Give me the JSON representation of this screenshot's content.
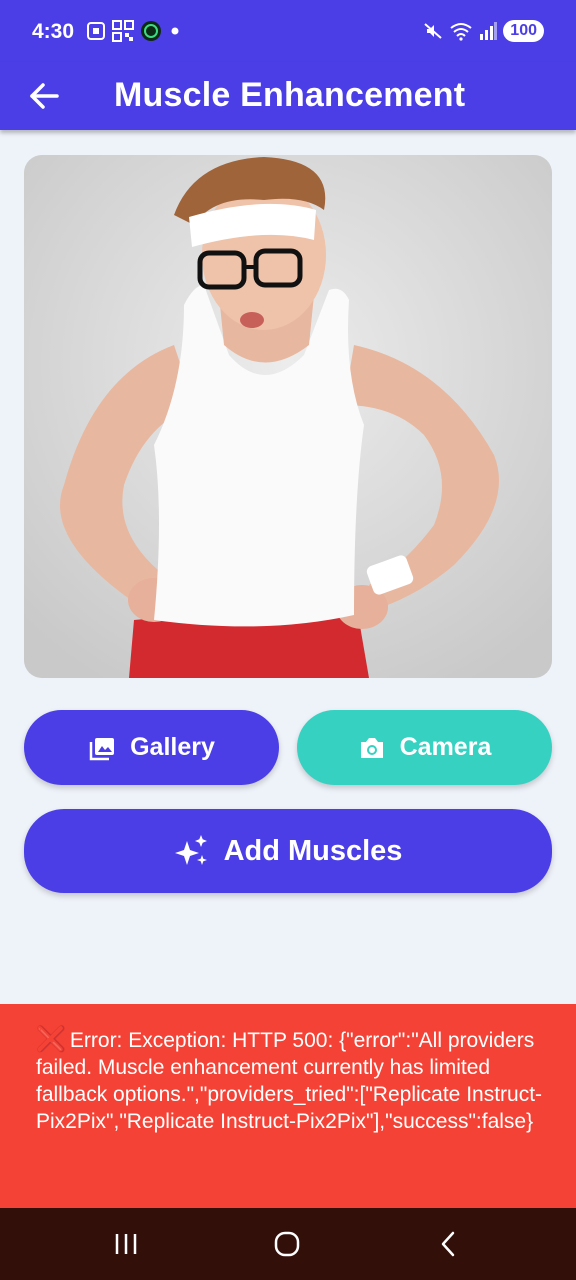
{
  "status_bar": {
    "time": "4:30",
    "battery": "100",
    "left_icons": [
      "screenshot-icon",
      "qr-icon",
      "app-icon",
      "dot-icon"
    ],
    "right_icons": [
      "mute-icon",
      "wifi-icon",
      "signal-icon"
    ]
  },
  "app_bar": {
    "title": "Muscle Enhancement",
    "back_icon": "arrow-left-icon"
  },
  "photo": {
    "description_icon": "selected-photo"
  },
  "buttons": {
    "gallery_label": "Gallery",
    "camera_label": "Camera",
    "add_muscles_label": "Add Muscles"
  },
  "error": {
    "icon": "❌",
    "message": "Error: Exception: HTTP 500: {\"error\":\"All providers failed. Muscle enhancement currently has limited fallback options.\",\"providers_tried\":[\"Replicate Instruct-Pix2Pix\",\"Replicate Instruct-Pix2Pix\"],\"success\":false}"
  },
  "colors": {
    "primary": "#4b3ee6",
    "accent": "#36d1c1",
    "error": "#f44336",
    "background": "#eef2f9"
  }
}
